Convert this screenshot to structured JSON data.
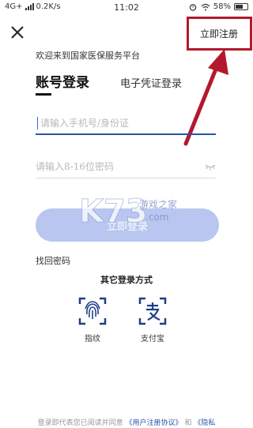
{
  "status_bar": {
    "network": "4G+",
    "speed": "0.2K/s",
    "time": "11:02",
    "battery": "58%"
  },
  "header": {
    "register_label": "立即注册"
  },
  "welcome_text": "欢迎来到国家医保服务平台",
  "tabs": {
    "account_login": "账号登录",
    "ecert_login": "电子凭证登录"
  },
  "form": {
    "phone_placeholder": "请输入手机号/身份证",
    "password_placeholder": "请输入8-16位密码",
    "login_label": "立即登录"
  },
  "forgot_password": "找回密码",
  "other_methods": {
    "title": "其它登录方式",
    "fingerprint": "指纹",
    "alipay": "支付宝"
  },
  "footer": {
    "text": "登录即代表您已阅读并同意",
    "agreement": "《用户注册协议》",
    "and": "和",
    "privacy": "《隐私"
  },
  "watermark": {
    "logo": "K73",
    "line1": "游戏之家",
    ".com": ".com"
  },
  "colors": {
    "accent_blue": "#2a55a4",
    "login_button": "#b9c6ef",
    "highlight_red": "#b3182c",
    "icon_blue": "#1f3f86"
  }
}
